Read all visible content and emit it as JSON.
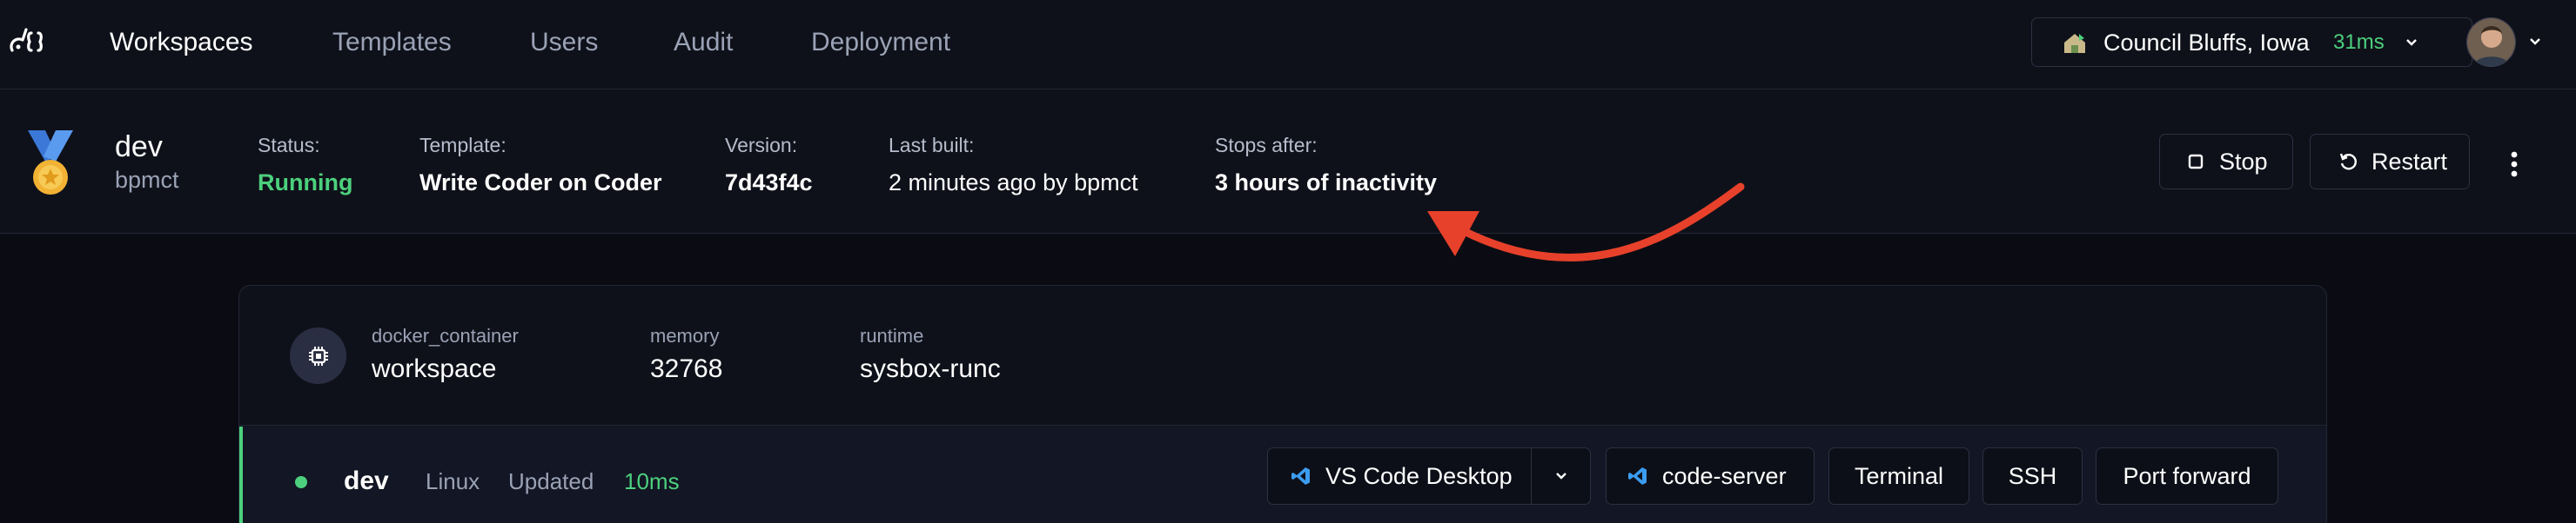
{
  "nav": {
    "items": [
      "Workspaces",
      "Templates",
      "Users",
      "Audit",
      "Deployment"
    ],
    "active": "Workspaces",
    "proxy": {
      "location": "Council Bluffs, Iowa",
      "latency": "31ms"
    }
  },
  "workspace": {
    "name": "dev",
    "owner": "bpmct",
    "status_label": "Status:",
    "status_value": "Running",
    "template_label": "Template:",
    "template_value": "Write Coder on Coder",
    "version_label": "Version:",
    "version_value": "7d43f4c",
    "last_built_label": "Last built:",
    "last_built_value": "2 minutes ago by bpmct",
    "stops_label": "Stops after:",
    "stops_value": "3 hours of inactivity",
    "actions": {
      "stop": "Stop",
      "restart": "Restart"
    }
  },
  "resource": {
    "type": "docker_container",
    "name": "workspace",
    "memory_label": "memory",
    "memory_value": "32768",
    "runtime_label": "runtime",
    "runtime_value": "sysbox-runc"
  },
  "agent": {
    "name": "dev",
    "os": "Linux",
    "updated_label": "Updated",
    "latency": "10ms",
    "apps": {
      "vscode": "VS Code Desktop",
      "code_server": "code-server",
      "terminal": "Terminal",
      "ssh": "SSH",
      "port_forward": "Port forward"
    }
  },
  "colors": {
    "background": "#0b0c13",
    "surface": "#0f111a",
    "running": "#4cd07d",
    "annotation_arrow": "#e8412b",
    "vscode_blue": "#3b9cf0"
  },
  "icons": [
    "coder-logo-icon",
    "house-flag-icon",
    "chevron-down-icon",
    "medal-icon",
    "stop-icon",
    "restart-icon",
    "kebab-menu-icon",
    "chip-icon",
    "vscode-icon"
  ]
}
